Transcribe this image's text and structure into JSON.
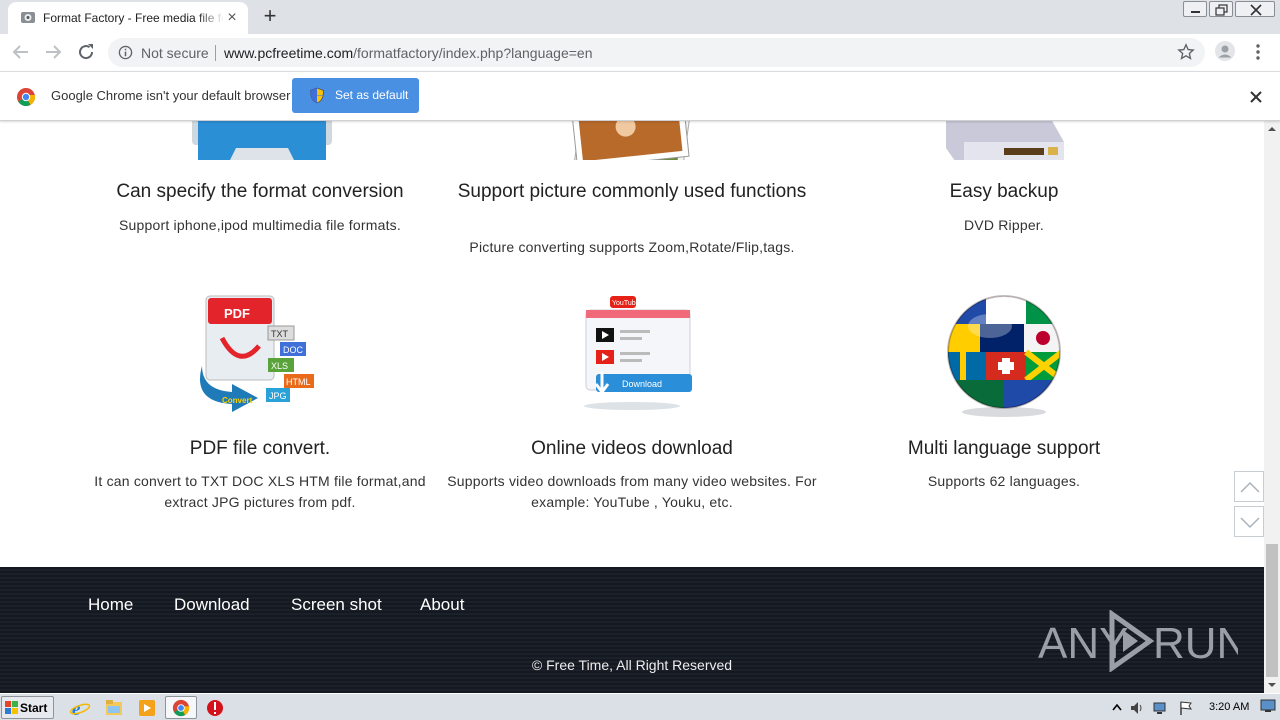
{
  "browser": {
    "tab": {
      "title": "Format Factory - Free media file format converter",
      "close_symbol": "×"
    },
    "new_tab_symbol": "+",
    "omnibox": {
      "security_label": "Not secure",
      "url_host": "www.pcfreetime.com",
      "url_path": "/formatfactory/index.php?language=en"
    },
    "infobar": {
      "message": "Google Chrome isn't your default browser",
      "button_label": "Set as default",
      "button_color": "#4a90e2"
    }
  },
  "features": [
    {
      "title": "Can specify the format conversion",
      "desc": "Support iphone,ipod multimedia file formats.",
      "icon": "monitor-icon"
    },
    {
      "title": "Support picture commonly used functions",
      "desc": "Picture converting supports Zoom,Rotate/Flip,tags.",
      "icon": "photos-icon"
    },
    {
      "title": "Easy backup",
      "desc": "DVD Ripper.",
      "icon": "dvd-drive-icon"
    },
    {
      "title": "PDF file convert.",
      "desc": "It can convert to TXT DOC XLS HTM file format,and extract JPG pictures from pdf.",
      "icon": "pdf-convert-icon",
      "badges": [
        "PDF",
        "TXT",
        "DOC",
        "XLS",
        "HTML",
        "JPG",
        "Convert"
      ]
    },
    {
      "title": "Online videos download",
      "desc": "Supports video downloads from many video websites. For example: YouTube , Youku, etc.",
      "icon": "video-download-icon",
      "badges": [
        "YouTube",
        "Download"
      ]
    },
    {
      "title": "Multi language support",
      "desc": "Supports 62 languages.",
      "icon": "flag-globe-icon"
    }
  ],
  "footer": {
    "links": [
      "Home",
      "Download",
      "Screen shot",
      "About"
    ],
    "copyright": "© Free Time, All Right Reserved",
    "watermark": [
      "ANY",
      "RUN"
    ]
  },
  "taskbar": {
    "start_label": "Start",
    "clock": "3:20 AM",
    "apps": [
      "ie-icon",
      "explorer-icon",
      "media-player-icon",
      "chrome-icon",
      "stop-icon"
    ]
  },
  "colors": {
    "footer_bg": "#141820",
    "accent_blue": "#4a90e2",
    "tab_bar": "#dee1e6"
  }
}
